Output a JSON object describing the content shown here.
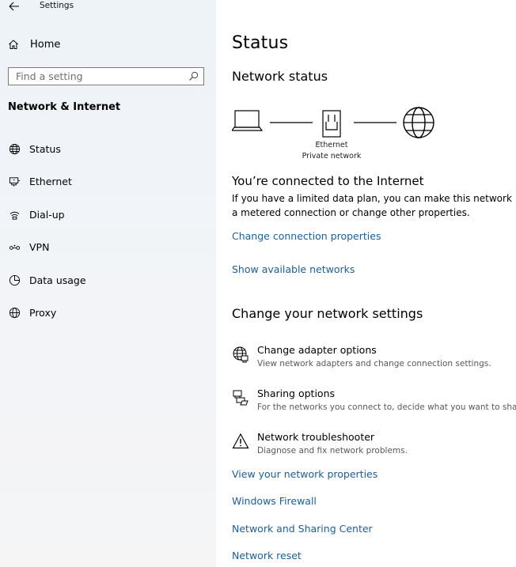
{
  "window": {
    "title": "Settings"
  },
  "sidebar": {
    "home_label": "Home",
    "search": {
      "placeholder": "Find a setting",
      "value": ""
    },
    "section_heading": "Network & Internet",
    "items": [
      {
        "label": "Status",
        "icon": "globe-icon"
      },
      {
        "label": "Ethernet",
        "icon": "ethernet-icon"
      },
      {
        "label": "Dial-up",
        "icon": "dialup-icon"
      },
      {
        "label": "VPN",
        "icon": "vpn-icon"
      },
      {
        "label": "Data usage",
        "icon": "data-usage-icon"
      },
      {
        "label": "Proxy",
        "icon": "proxy-globe-icon"
      }
    ]
  },
  "main": {
    "title": "Status",
    "network_status_heading": "Network status",
    "diagram": {
      "adapter_name": "Ethernet",
      "network_profile": "Private network"
    },
    "connected_title": "You’re connected to the Internet",
    "connected_desc": "If you have a limited data plan, you can make this network a metered connection or change other properties.",
    "link_change_connection": "Change connection properties",
    "link_show_networks": "Show available networks",
    "change_settings_heading": "Change your network settings",
    "settings": [
      {
        "title": "Change adapter options",
        "desc": "View network adapters and change connection settings.",
        "icon": "adapter-globe-icon"
      },
      {
        "title": "Sharing options",
        "desc": "For the networks you connect to, decide what you want to share.",
        "icon": "sharing-icon"
      },
      {
        "title": "Network troubleshooter",
        "desc": "Diagnose and fix network problems.",
        "icon": "warning-icon"
      }
    ],
    "links": [
      "View your network properties",
      "Windows Firewall",
      "Network and Sharing Center",
      "Network reset"
    ]
  },
  "colors": {
    "link": "#1a5fa0",
    "sidebar_bg": "#eef3f8"
  }
}
